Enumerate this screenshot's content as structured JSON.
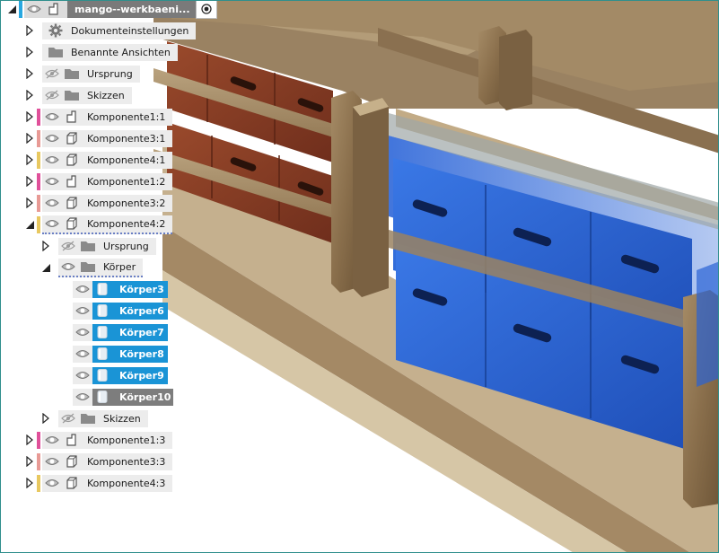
{
  "browser": {
    "root": {
      "label": "mango--werkbaeni...",
      "stripe": "#29a8e0"
    },
    "items": [
      {
        "id": "doc",
        "label": "Dokumenteinstellungen",
        "icon": "gear-icon",
        "tri": "right",
        "eye": "none"
      },
      {
        "id": "views",
        "label": "Benannte Ansichten",
        "icon": "folder-icon",
        "tri": "right",
        "eye": "none"
      },
      {
        "id": "origin",
        "label": "Ursprung",
        "icon": "folder-icon",
        "tri": "right",
        "eye": "hidden"
      },
      {
        "id": "sketches",
        "label": "Skizzen",
        "icon": "folder-icon",
        "tri": "right",
        "eye": "hidden"
      },
      {
        "id": "k11",
        "label": "Komponente1:1",
        "icon": "component-icon",
        "tri": "right",
        "eye": "visible",
        "stripe": "#e0509a"
      },
      {
        "id": "k31",
        "label": "Komponente3:1",
        "icon": "body-box-icon",
        "tri": "right",
        "eye": "visible",
        "stripe": "#e89a95"
      },
      {
        "id": "k41",
        "label": "Komponente4:1",
        "icon": "body-box-icon",
        "tri": "right",
        "eye": "visible",
        "stripe": "#e8c860"
      },
      {
        "id": "k12",
        "label": "Komponente1:2",
        "icon": "component-icon",
        "tri": "right",
        "eye": "visible",
        "stripe": "#e0509a"
      },
      {
        "id": "k32",
        "label": "Komponente3:2",
        "icon": "body-box-icon",
        "tri": "right",
        "eye": "visible",
        "stripe": "#e89a95"
      },
      {
        "id": "k42",
        "label": "Komponente4:2",
        "icon": "body-box-icon",
        "tri": "down",
        "eye": "visible",
        "stripe": "#e8c860",
        "active": true
      },
      {
        "id": "k42-origin",
        "label": "Ursprung",
        "icon": "folder-icon",
        "tri": "right",
        "eye": "hidden",
        "level": 1
      },
      {
        "id": "k42-bodies",
        "label": "Körper",
        "icon": "folder-icon",
        "tri": "down",
        "eye": "visible",
        "level": 1,
        "active": true
      },
      {
        "id": "b3",
        "label": "Körper3",
        "icon": "body-icon",
        "eye": "visible",
        "level": 2,
        "selected": true
      },
      {
        "id": "b6",
        "label": "Körper6",
        "icon": "body-icon",
        "eye": "visible",
        "level": 2,
        "selected": true
      },
      {
        "id": "b7",
        "label": "Körper7",
        "icon": "body-icon",
        "eye": "visible",
        "level": 2,
        "selected": true
      },
      {
        "id": "b8",
        "label": "Körper8",
        "icon": "body-icon",
        "eye": "visible",
        "level": 2,
        "selected": true
      },
      {
        "id": "b9",
        "label": "Körper9",
        "icon": "body-icon",
        "eye": "visible",
        "level": 2,
        "selected": true
      },
      {
        "id": "b10",
        "label": "Körper10",
        "icon": "body-icon",
        "eye": "visible",
        "level": 2,
        "selected": true,
        "last": true
      },
      {
        "id": "k42-sketches",
        "label": "Skizzen",
        "icon": "folder-icon",
        "tri": "right",
        "eye": "hidden",
        "level": 1
      },
      {
        "id": "k13",
        "label": "Komponente1:3",
        "icon": "component-icon",
        "tri": "right",
        "eye": "visible",
        "stripe": "#e0509a"
      },
      {
        "id": "k33",
        "label": "Komponente3:3",
        "icon": "body-box-icon",
        "tri": "right",
        "eye": "visible",
        "stripe": "#e89a95"
      },
      {
        "id": "k43",
        "label": "Komponente4:3",
        "icon": "body-box-icon",
        "tri": "right",
        "eye": "visible",
        "stripe": "#e8c860"
      }
    ]
  },
  "colors": {
    "selection": "#1a94d6",
    "selection_last": "#7d7d7d",
    "wood": "#8c6f4c",
    "drawer_red": "#8a3d25",
    "drawer_blue": "#2a63d4"
  }
}
